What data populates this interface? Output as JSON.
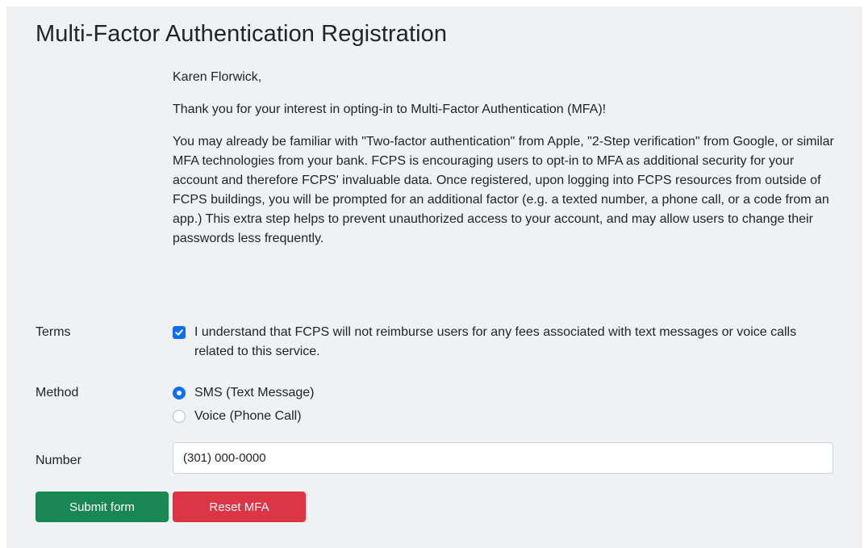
{
  "page": {
    "title": "Multi-Factor Authentication Registration"
  },
  "intro": {
    "greeting": "Karen Florwick,",
    "thanks": "Thank you for your interest in opting-in to Multi-Factor Authentication (MFA)!",
    "description": "You may already be familiar with \"Two-factor authentication\" from Apple, \"2-Step verification\" from Google, or similar MFA technologies from your bank. FCPS is encouraging users to opt-in to MFA as additional security for your account and therefore FCPS' invaluable data. Once registered, upon logging into FCPS resources from outside of FCPS buildings, you will be prompted for an additional factor (e.g. a texted number, a phone call, or a code from an app.) This extra step helps to prevent unauthorized access to your account, and may allow users to change their passwords less frequently."
  },
  "form": {
    "terms": {
      "label": "Terms",
      "checkbox_text": "I understand that FCPS will not reimburse users for any fees associated with text messages or voice calls related to this service.",
      "checked": true
    },
    "method": {
      "label": "Method",
      "options": [
        {
          "label": "SMS (Text Message)",
          "selected": true
        },
        {
          "label": "Voice (Phone Call)",
          "selected": false
        }
      ]
    },
    "number": {
      "label": "Number",
      "value": "(301) 000-0000"
    },
    "buttons": {
      "submit_label": "Submit form",
      "reset_label": "Reset MFA"
    }
  },
  "colors": {
    "panel_background": "#eff1f3",
    "accent_blue": "#0d6efd",
    "submit_green": "#198754",
    "reset_red": "#dc3545"
  }
}
